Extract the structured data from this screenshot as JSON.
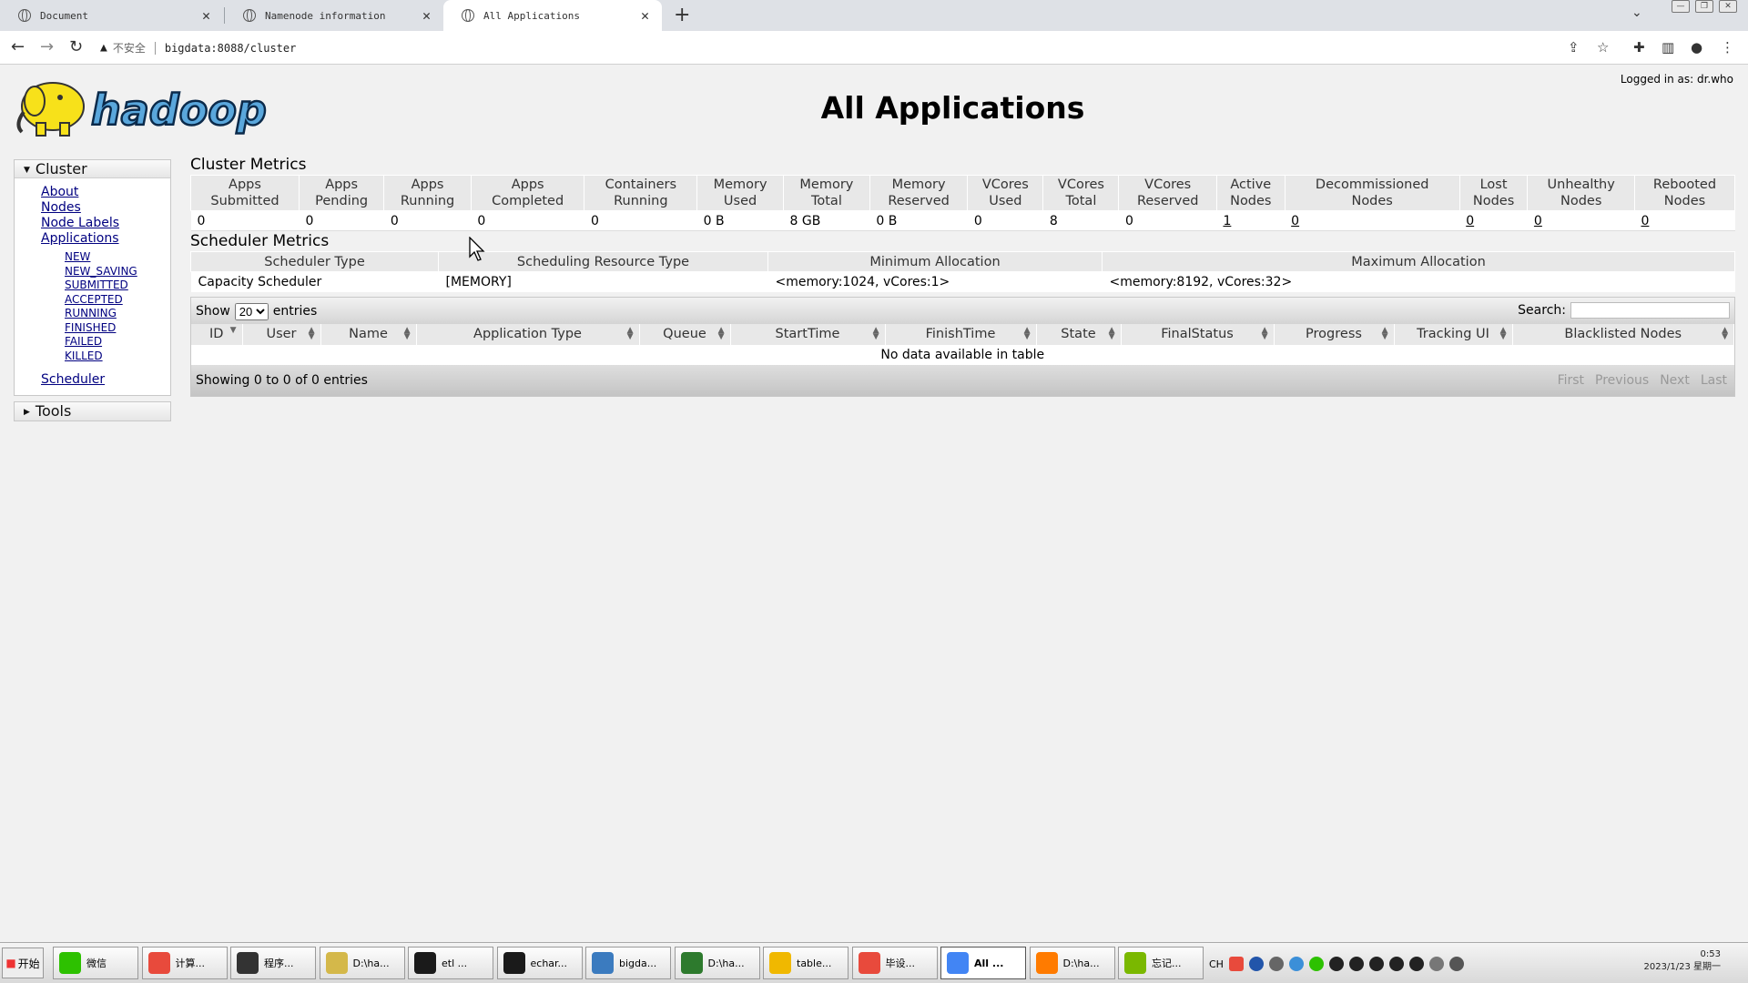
{
  "browser": {
    "tabs": [
      {
        "title": "Document"
      },
      {
        "title": "Namenode information"
      },
      {
        "title": "All Applications"
      }
    ],
    "address": {
      "security_label": "不安全",
      "url": "bigdata:8088/cluster"
    }
  },
  "page": {
    "title": "All Applications",
    "logged_in": "Logged in as: dr.who",
    "logo_text": "hadoop"
  },
  "sidebar": {
    "cluster": {
      "label": "Cluster",
      "links": [
        "About",
        "Nodes",
        "Node Labels",
        "Applications"
      ],
      "app_states": [
        "NEW",
        "NEW_SAVING",
        "SUBMITTED",
        "ACCEPTED",
        "RUNNING",
        "FINISHED",
        "FAILED",
        "KILLED"
      ],
      "scheduler": "Scheduler"
    },
    "tools": {
      "label": "Tools"
    }
  },
  "cluster_metrics": {
    "title": "Cluster Metrics",
    "headers": [
      [
        "Apps",
        "Submitted"
      ],
      [
        "Apps",
        "Pending"
      ],
      [
        "Apps",
        "Running"
      ],
      [
        "Apps",
        "Completed"
      ],
      [
        "Containers",
        "Running"
      ],
      [
        "Memory",
        "Used"
      ],
      [
        "Memory",
        "Total"
      ],
      [
        "Memory",
        "Reserved"
      ],
      [
        "VCores",
        "Used"
      ],
      [
        "VCores",
        "Total"
      ],
      [
        "VCores",
        "Reserved"
      ],
      [
        "Active",
        "Nodes"
      ],
      [
        "Decommissioned",
        "Nodes"
      ],
      [
        "Lost",
        "Nodes"
      ],
      [
        "Unhealthy",
        "Nodes"
      ],
      [
        "Rebooted",
        "Nodes"
      ]
    ],
    "values": [
      "0",
      "0",
      "0",
      "0",
      "0",
      "0 B",
      "8 GB",
      "0 B",
      "0",
      "8",
      "0",
      "1",
      "0",
      "0",
      "0",
      "0"
    ]
  },
  "scheduler_metrics": {
    "title": "Scheduler Metrics",
    "headers": [
      "Scheduler Type",
      "Scheduling Resource Type",
      "Minimum Allocation",
      "Maximum Allocation"
    ],
    "values": [
      "Capacity Scheduler",
      "[MEMORY]",
      "<memory:1024, vCores:1>",
      "<memory:8192, vCores:32>"
    ]
  },
  "apps_table": {
    "show_label": "Show",
    "entries_value": "20",
    "entries_label": "entries",
    "search_label": "Search:",
    "columns": [
      "ID",
      "User",
      "Name",
      "Application Type",
      "Queue",
      "StartTime",
      "FinishTime",
      "State",
      "FinalStatus",
      "Progress",
      "Tracking UI",
      "Blacklisted Nodes"
    ],
    "empty_message": "No data available in table",
    "info": "Showing 0 to 0 of 0 entries",
    "pager": [
      "First",
      "Previous",
      "Next",
      "Last"
    ]
  },
  "taskbar": {
    "start_label": "开始",
    "tasks": [
      "微信",
      "计算...",
      "程序...",
      "D:\\ha...",
      "etl ...",
      "echar...",
      "bigda...",
      "D:\\ha...",
      "table...",
      "毕设...",
      "All ...",
      "D:\\ha...",
      "忘记..."
    ],
    "task_colors": [
      "#2dc100",
      "#e84a3c",
      "#333333",
      "#d4b84a",
      "#1a1a1a",
      "#1a1a1a",
      "#3b7bbf",
      "#2d7a2d",
      "#f0b800",
      "#e84a3c",
      "#4285f4",
      "#ff7b00",
      "#7ab800"
    ],
    "ime": "CH",
    "clock_time": "0:53",
    "clock_date": "2023/1/23 星期一"
  }
}
